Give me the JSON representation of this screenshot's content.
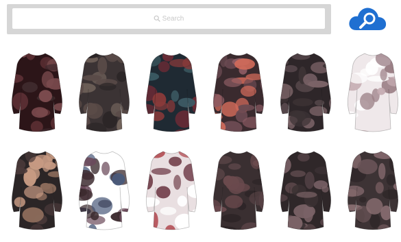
{
  "search": {
    "placeholder": "Search"
  },
  "accent_color": "#1f6fd1",
  "icons": {
    "search": "search-icon",
    "cloud_search": "cloud-search-icon"
  },
  "products": [
    {
      "style": "long-sleeve-dress",
      "colors": [
        "#2c1518",
        "#5b2f33",
        "#7a4a4d",
        "#3e2a2d"
      ]
    },
    {
      "style": "long-sleeve-dress",
      "colors": [
        "#3b3334",
        "#5a4b48",
        "#72645c",
        "#2b2526"
      ]
    },
    {
      "style": "long-sleeve-dress",
      "colors": [
        "#1f2a33",
        "#6b2a35",
        "#3c5a63",
        "#8a3a3a"
      ]
    },
    {
      "style": "long-sleeve-dress",
      "colors": [
        "#3a2a2e",
        "#6b4a52",
        "#d06a5a",
        "#8a5a62"
      ]
    },
    {
      "style": "long-sleeve-dress",
      "colors": [
        "#2e2629",
        "#56474b",
        "#7b6367",
        "#3d3335"
      ]
    },
    {
      "style": "long-sleeve-dress",
      "colors": [
        "#efe8ea",
        "#c4aab0",
        "#9b7f86",
        "#ffffff"
      ]
    },
    {
      "style": "long-sleeve-dress",
      "colors": [
        "#2b2526",
        "#8a6a5a",
        "#c69a83",
        "#4b3a3a"
      ]
    },
    {
      "style": "long-sleeve-dress",
      "colors": [
        "#ffffff",
        "#3b2a2e",
        "#6b4a5a",
        "#4a5a7a"
      ]
    },
    {
      "style": "long-sleeve-dress",
      "colors": [
        "#e9dfe1",
        "#b85a60",
        "#7a4a55",
        "#ffffff"
      ]
    },
    {
      "style": "long-sleeve-dress",
      "colors": [
        "#3a2f31",
        "#6b4a4e",
        "#574245",
        "#2e2527"
      ]
    },
    {
      "style": "long-sleeve-dress",
      "colors": [
        "#2f2729",
        "#5a464a",
        "#7a6266",
        "#3b3133"
      ]
    },
    {
      "style": "long-sleeve-dress",
      "colors": [
        "#3d3335",
        "#6b5558",
        "#8a6e72",
        "#2e2628"
      ]
    }
  ]
}
